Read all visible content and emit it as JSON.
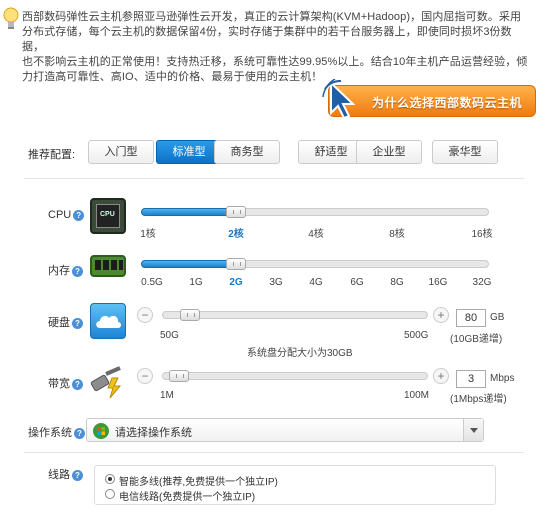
{
  "intro": {
    "line1": "西部数码弹性云主机参照亚马逊弹性云开发，真正的云计算架构(KVM+Hadoop)，国内屈指可数。采用",
    "line2": "分布式存储，每个云主机的数据保留4份，实时存储于集群中的若干台服务器上，即使同时损坏3份数据，",
    "line3": "也不影响云主机的正常使用！支持热迁移，系统可靠性达99.95%以上。结合10年主机产品运营经验，倾",
    "line4": "力打造高可靠性、高IO、适中的价格、最易于使用的云主机！"
  },
  "why_button": "为什么选择西部数码云主机",
  "presets": {
    "label": "推荐配置:",
    "items": [
      "入门型",
      "标准型",
      "商务型",
      "舒适型",
      "企业型",
      "豪华型"
    ],
    "active_index": 1
  },
  "cpu": {
    "label": "CPU",
    "icon_text": "CPU",
    "ticks": [
      "1核",
      "2核",
      "4核",
      "8核",
      "16核"
    ],
    "selected": "2核"
  },
  "memory": {
    "label": "内存",
    "ticks": [
      "0.5G",
      "1G",
      "2G",
      "3G",
      "4G",
      "6G",
      "8G",
      "16G",
      "32G"
    ],
    "selected": "2G"
  },
  "disk": {
    "label": "硬盘",
    "min_label": "50G",
    "max_label": "500G",
    "value": "80",
    "unit": "GB",
    "step_note": "(10GB递增)",
    "system_note": "系统盘分配大小为30GB",
    "minus": "−",
    "plus": "+",
    "level_fraction": 0.067
  },
  "bandwidth": {
    "label": "带宽",
    "min_label": "1M",
    "max_label": "100M",
    "value": "3",
    "unit": "Mbps",
    "step_note": "(1Mbps递增)",
    "minus": "−",
    "plus": "+",
    "level_fraction": 0.02
  },
  "os": {
    "label": "操作系统",
    "placeholder": "请选择操作系统"
  },
  "line": {
    "label": "线路",
    "options": [
      "智能多线(推荐,免费提供一个独立IP)",
      "电信线路(免费提供一个独立IP)"
    ],
    "selected_index": 0
  },
  "help_glyph": "?",
  "colors": {
    "accent": "#1a83cf",
    "orange": "#f07b0f"
  }
}
